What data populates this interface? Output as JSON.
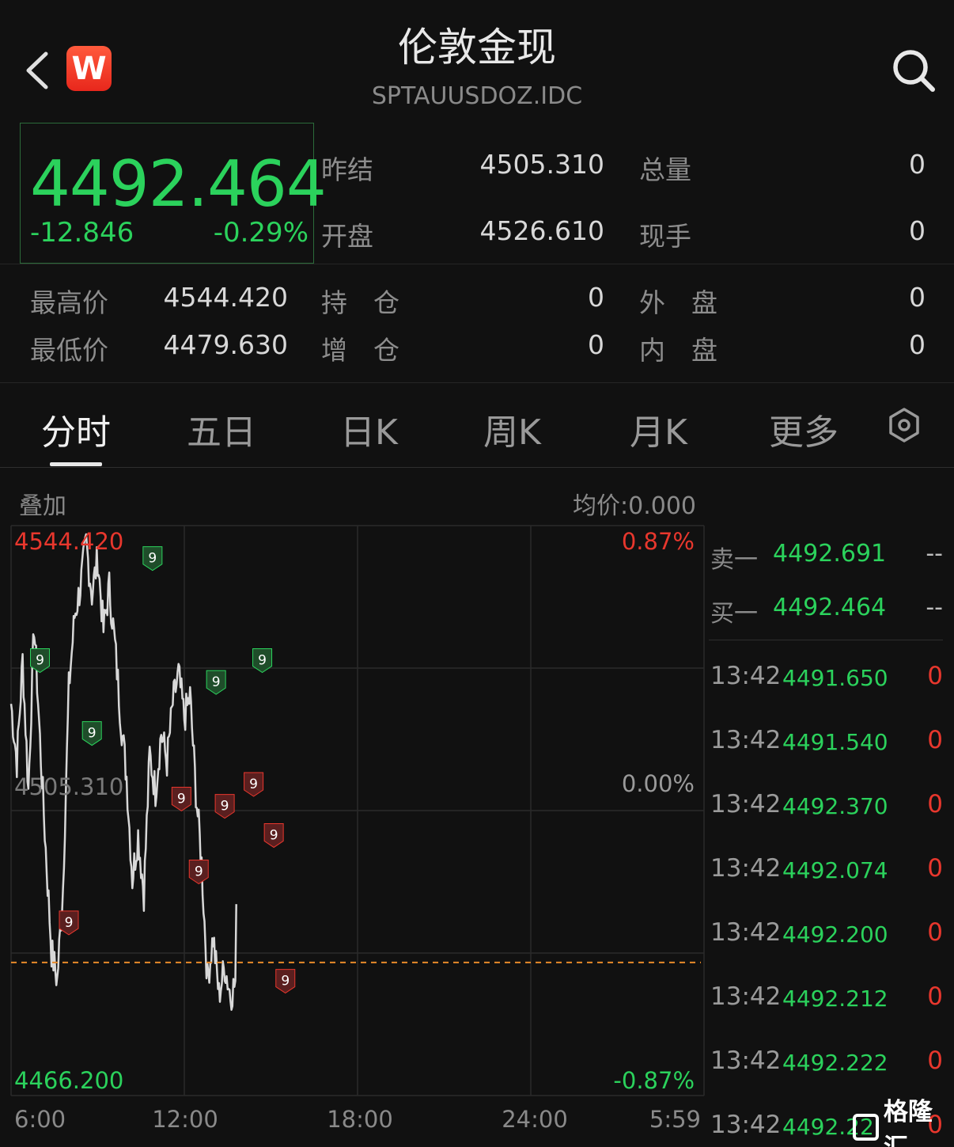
{
  "header": {
    "title": "伦敦金现",
    "code": "SPTAUUSDOZ.IDC",
    "logo_letter": "W"
  },
  "quote": {
    "price": "4492.464",
    "change": "-12.846",
    "change_pct": "-0.29%"
  },
  "stats": [
    {
      "label": "昨结",
      "value": "4505.310"
    },
    {
      "label": "总量",
      "value": "0"
    },
    {
      "label": "开盘",
      "value": "4526.610"
    },
    {
      "label": "现手",
      "value": "0"
    },
    {
      "label": "最高价",
      "value": "4544.420"
    },
    {
      "label": "持　仓",
      "value": "0"
    },
    {
      "label": "外　盘",
      "value": "0"
    },
    {
      "label": "最低价",
      "value": "4479.630"
    },
    {
      "label": "增　仓",
      "value": "0"
    },
    {
      "label": "内　盘",
      "value": "0"
    }
  ],
  "tabs": [
    "分时",
    "五日",
    "日K",
    "周K",
    "月K",
    "更多"
  ],
  "active_tab": 0,
  "chart_header": {
    "overlay": "叠加",
    "avg_price": "均价:0.000"
  },
  "chart_data": {
    "type": "line",
    "y_max_label": "4544.420",
    "y_mid_label": "4505.310",
    "y_min_label": "4466.200",
    "pct_max_label": "0.87%",
    "pct_mid_label": "0.00%",
    "pct_min_label": "-0.87%",
    "x_labels": [
      "6:00",
      "12:00",
      "18:00",
      "24:00",
      "5:59"
    ],
    "ylim": [
      4466.2,
      4544.42
    ],
    "prev_settle": 4505.31,
    "current_price": 4492.464,
    "hours_elapsed_range": [
      0,
      24
    ],
    "series": [
      {
        "hours": [
          0,
          0.2,
          0.4,
          0.6,
          0.8,
          1.0,
          1.2,
          1.4,
          1.6,
          1.8,
          2.0,
          2.2,
          2.4,
          2.6,
          2.8,
          3.0,
          3.2,
          3.4,
          3.6,
          3.8,
          4.0,
          4.2,
          4.4,
          4.6,
          4.8,
          5.0,
          5.2,
          5.4,
          5.6,
          5.8,
          6.0,
          6.2,
          6.4,
          6.6,
          6.8,
          7.0,
          7.2,
          7.4,
          7.6,
          7.8
        ],
        "values": [
          4520,
          4512,
          4526,
          4508,
          4531,
          4515,
          4500,
          4486,
          4482,
          4495,
          4522,
          4532,
          4536,
          4542,
          4535,
          4540,
          4530,
          4536,
          4528,
          4518,
          4510,
          4496,
          4502,
          4494,
          4513,
          4508,
          4516,
          4512,
          4520,
          4524,
          4518,
          4521,
          4508,
          4498,
          4482,
          4488,
          4480,
          4484,
          4480,
          4482
        ]
      }
    ],
    "markers": [
      {
        "hour": 1.0,
        "value": 4526,
        "label": "9",
        "type": "sell"
      },
      {
        "hour": 4.9,
        "value": 4540,
        "label": "9",
        "type": "sell"
      },
      {
        "hour": 2.8,
        "value": 4516,
        "label": "9",
        "type": "sell"
      },
      {
        "hour": 7.1,
        "value": 4523,
        "label": "9",
        "type": "sell"
      },
      {
        "hour": 8.7,
        "value": 4526,
        "label": "9",
        "type": "sell"
      },
      {
        "hour": 2.0,
        "value": 4490,
        "label": "9",
        "type": "buy"
      },
      {
        "hour": 6.5,
        "value": 4497,
        "label": "9",
        "type": "buy"
      },
      {
        "hour": 5.9,
        "value": 4507,
        "label": "9",
        "type": "buy"
      },
      {
        "hour": 7.4,
        "value": 4506,
        "label": "9",
        "type": "buy"
      },
      {
        "hour": 8.4,
        "value": 4509,
        "label": "9",
        "type": "buy"
      },
      {
        "hour": 9.1,
        "value": 4502,
        "label": "9",
        "type": "buy"
      },
      {
        "hour": 9.5,
        "value": 4482,
        "label": "9",
        "type": "buy"
      }
    ]
  },
  "order_book": {
    "ask": {
      "label": "卖一",
      "price": "4492.691",
      "vol": "--"
    },
    "bid": {
      "label": "买一",
      "price": "4492.464",
      "vol": "--"
    }
  },
  "trades": [
    {
      "time": "13:42",
      "price": "4491.650",
      "vol": "0"
    },
    {
      "time": "13:42",
      "price": "4491.540",
      "vol": "0"
    },
    {
      "time": "13:42",
      "price": "4492.370",
      "vol": "0"
    },
    {
      "time": "13:42",
      "price": "4492.074",
      "vol": "0"
    },
    {
      "time": "13:42",
      "price": "4492.200",
      "vol": "0"
    },
    {
      "time": "13:42",
      "price": "4492.212",
      "vol": "0"
    },
    {
      "time": "13:42",
      "price": "4492.222",
      "vol": "0"
    },
    {
      "time": "13:42",
      "price": "4492.22",
      "vol": "0"
    }
  ],
  "watermark": "格隆汇",
  "colors": {
    "up": "#e8372d",
    "down": "#2bd25c",
    "line": "#d8d8d8",
    "avg_dash": "#e88a2a"
  }
}
